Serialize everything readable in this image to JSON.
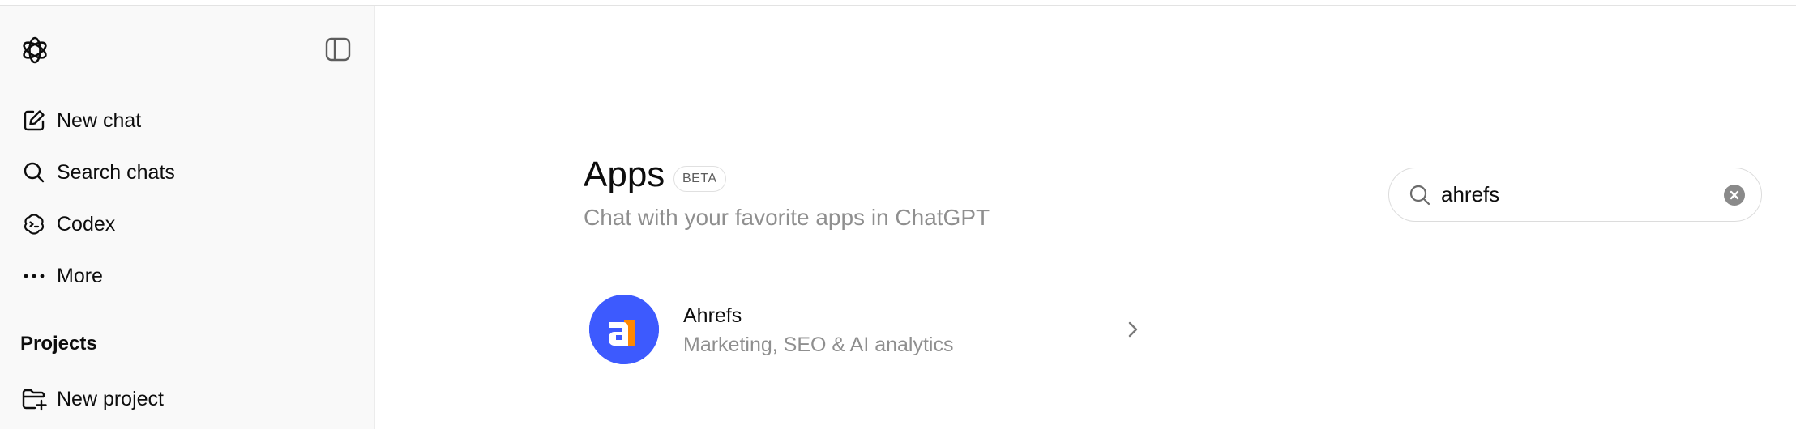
{
  "sidebar": {
    "logo_icon": "openai-logo-icon",
    "toggle_icon": "sidebar-toggle-icon",
    "nav": [
      {
        "label": "New chat",
        "icon": "edit-icon"
      },
      {
        "label": "Search chats",
        "icon": "search-icon"
      },
      {
        "label": "Codex",
        "icon": "codex-icon"
      },
      {
        "label": "More",
        "icon": "more-dots-icon"
      }
    ],
    "projects_title": "Projects",
    "new_project": {
      "label": "New project",
      "icon": "folder-plus-icon"
    }
  },
  "main": {
    "title": "Apps",
    "badge": "BETA",
    "subtitle": "Chat with your favorite apps in ChatGPT",
    "search": {
      "value": "ahrefs",
      "icon": "search-icon",
      "clear_icon": "clear-icon"
    },
    "apps": [
      {
        "name": "Ahrefs",
        "description": "Marketing, SEO & AI analytics",
        "icon": "ahrefs-logo-icon",
        "chevron": "chevron-right-icon"
      }
    ]
  },
  "colors": {
    "sidebar_bg": "#f9f9f9",
    "ahrefs_blue": "#3d5afe",
    "ahrefs_orange": "#ff8800",
    "muted_text": "#8f8f8f"
  }
}
